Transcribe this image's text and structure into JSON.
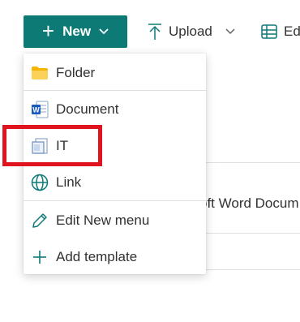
{
  "toolbar": {
    "new_label": "New",
    "upload_label": "Upload",
    "edit_label": "Ed"
  },
  "background": {
    "row_text": "oft Word Docum"
  },
  "menu": {
    "items": [
      {
        "label": "Folder",
        "icon": "folder-icon"
      },
      {
        "label": "Document",
        "icon": "word-document-icon"
      },
      {
        "label": "IT",
        "icon": "template-file-icon"
      },
      {
        "label": "Link",
        "icon": "globe-icon"
      },
      {
        "label": "Edit New menu",
        "icon": "pencil-icon"
      },
      {
        "label": "Add template",
        "icon": "plus-icon"
      }
    ]
  },
  "colors": {
    "accent": "#0e7a76",
    "highlight": "#e0141e"
  }
}
